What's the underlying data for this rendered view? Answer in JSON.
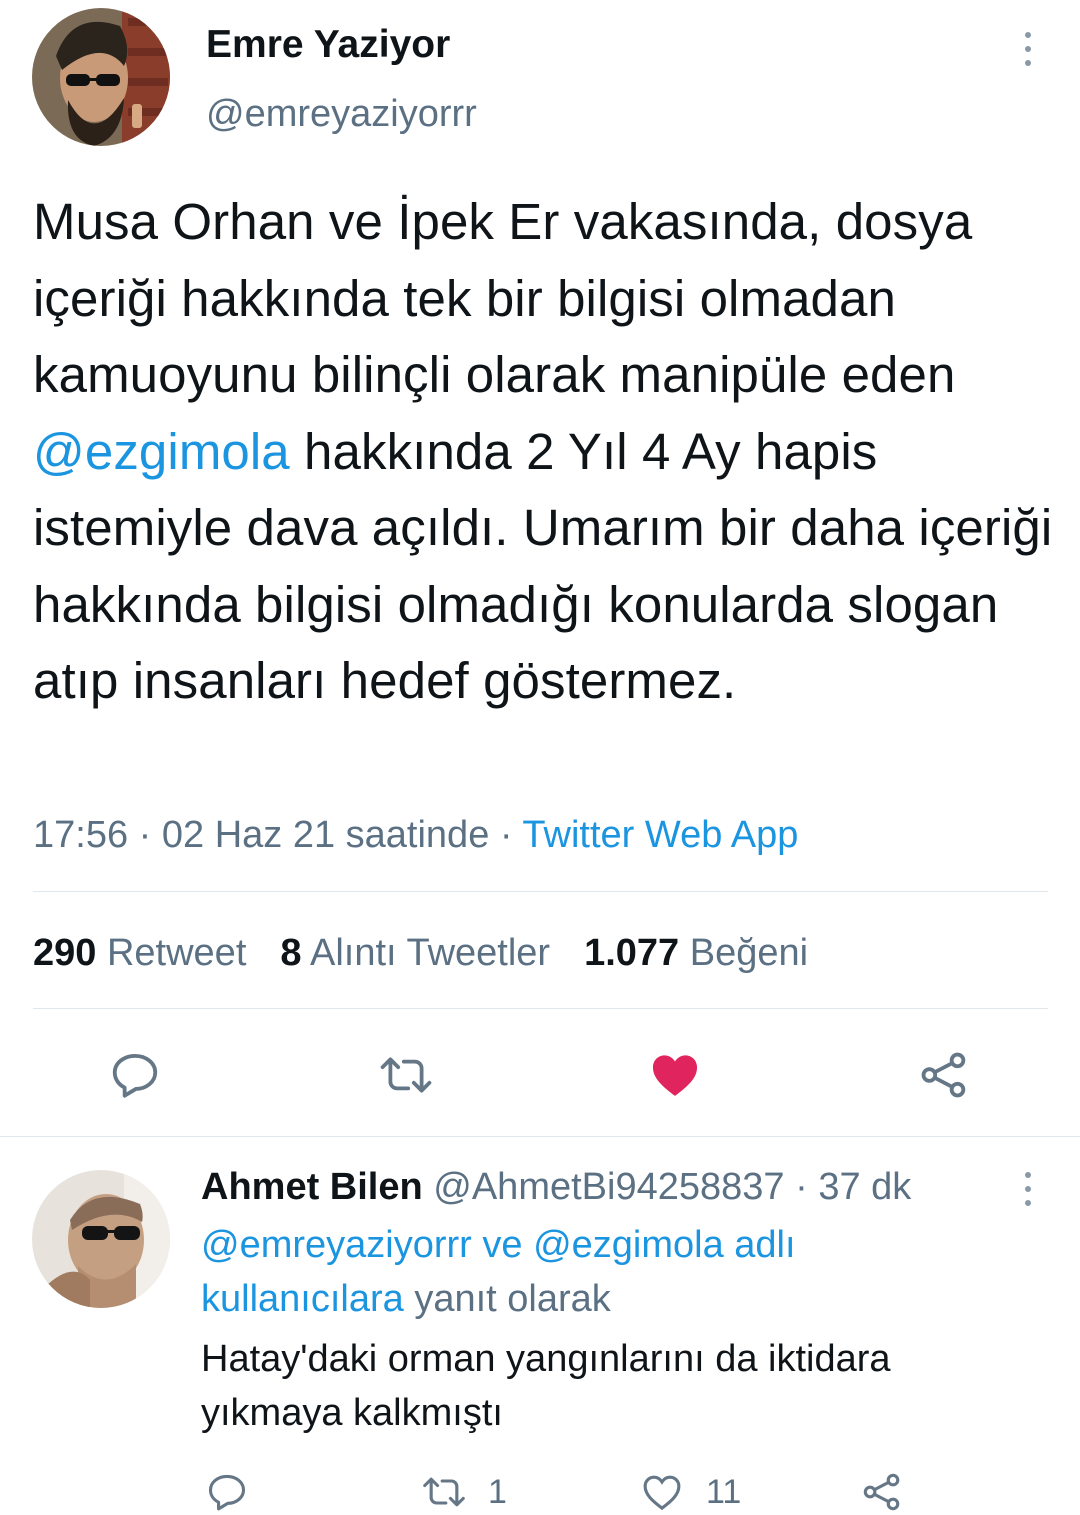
{
  "tweet": {
    "author_name": "Emre Yaziyor",
    "author_handle": "@emreyaziyorrr",
    "text_before": "Musa Orhan ve İpek Er vakasında, dosya içeriği hakkında tek bir bilgisi olmadan kamuoyunu bilinçli olarak manipüle eden ",
    "mention": "@ezgimola",
    "text_after": " hakkında 2 Yıl 4 Ay hapis istemiyle dava açıldı. Umarım bir daha içeriği hakkında bilgisi olmadığı konularda slogan atıp insanları hedef göstermez.",
    "time": "17:56",
    "sep": " · ",
    "date": "02 Haz 21 saatinde",
    "source": "Twitter Web App",
    "stats": {
      "retweets_count": "290",
      "retweets_label": "Retweet",
      "quotes_count": "8",
      "quotes_label": "Alıntı Tweetler",
      "likes_count": "1.077",
      "likes_label": "Beğeni"
    },
    "liked": true
  },
  "reply": {
    "author_name": "Ahmet Bilen",
    "author_handle": "@AhmetBi94258837",
    "time_sep": " · ",
    "time_ago": "37 dk",
    "reply_to_users": "@emreyaziyorrr ve @ezgimola adlı kullanıcılara",
    "reply_to_suffix": " yanıt olarak",
    "text": "Hatay'daki orman yangınlarını da iktidara yıkmaya kalkmıştı",
    "retweet_count": "1",
    "like_count": "11"
  },
  "icons": [
    "more-icon",
    "reply-icon",
    "retweet-icon",
    "like-icon",
    "share-icon"
  ],
  "colors": {
    "link": "#1b95e0",
    "like": "#e0245e",
    "secondary": "#5b7083",
    "icon": "#657786"
  }
}
